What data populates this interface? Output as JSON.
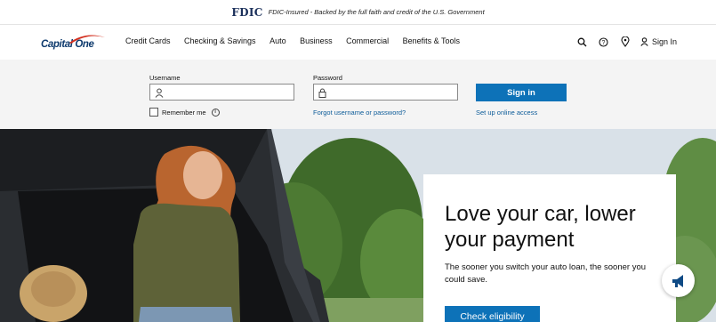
{
  "fdic": {
    "logo": "FDIC",
    "text": "FDIC-Insured - Backed by the full faith and credit of the U.S. Government"
  },
  "header": {
    "logo": "Capital One",
    "nav": [
      "Credit Cards",
      "Checking & Savings",
      "Auto",
      "Business",
      "Commercial",
      "Benefits & Tools"
    ],
    "icons": [
      "search-icon",
      "help-icon",
      "location-icon",
      "user-icon"
    ],
    "signin": "Sign In"
  },
  "login": {
    "username_label": "Username",
    "password_label": "Password",
    "username_value": "",
    "password_value": "",
    "remember": "Remember me",
    "forgot": "Forgot username or password?",
    "signin_button": "Sign in",
    "setup": "Set up online access"
  },
  "hero": {
    "headline": "Love your car, lower your payment",
    "sub": "The sooner you switch your auto loan, the sooner you could save.",
    "cta": "Check eligibility"
  },
  "colors": {
    "brand_navy": "#0f3b6e",
    "brand_red": "#d22e1e",
    "button_blue": "#0d72b8",
    "link_blue": "#0d5c99"
  }
}
